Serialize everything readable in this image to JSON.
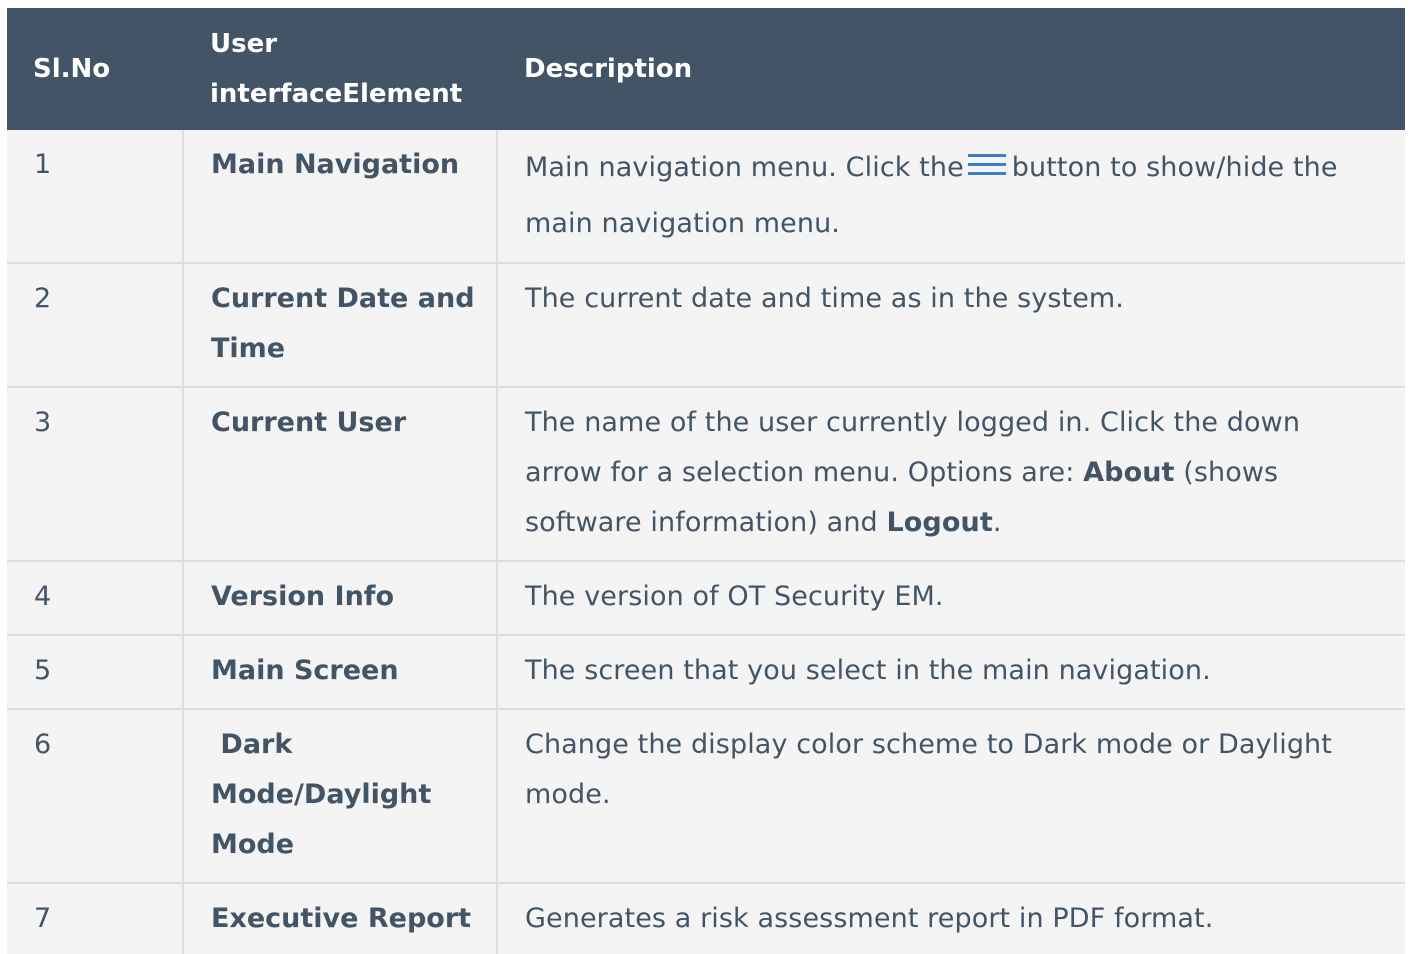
{
  "table": {
    "headers": {
      "sl_no": "Sl.No",
      "element": "User interfaceElement",
      "description": "Description"
    },
    "rows": [
      {
        "num": "1",
        "element": "Main Navigation",
        "desc_before": "Main navigation menu. Click the",
        "icon": "menu-icon",
        "desc_after": "button to show/hide the main navigation menu."
      },
      {
        "num": "2",
        "element": "Current Date and Time",
        "desc": "The current date and time as in the system."
      },
      {
        "num": "3",
        "element": "Current User",
        "desc_part1": "The name of the user currently logged in. Click the down arrow for a selection menu. Options are: ",
        "desc_bold1": "About",
        "desc_part2": " (shows software information) and ",
        "desc_bold2": "Logout",
        "desc_part3": "."
      },
      {
        "num": "4",
        "element": "Version Info",
        "desc": "The version of OT Security EM."
      },
      {
        "num": "5",
        "element": "Main Screen",
        "desc": "The screen that you select in the main navigation."
      },
      {
        "num": "6",
        "element": " Dark Mode/Daylight Mode",
        "desc": "Change the display color scheme to Dark mode or Daylight mode."
      },
      {
        "num": "7",
        "element": "Executive Report",
        "desc": "Generates a risk assessment report in PDF format."
      }
    ]
  },
  "colors": {
    "header_bg": "#425466",
    "header_text": "#ffffff",
    "body_text": "#425466",
    "row_bg": "#f4f4f4",
    "border": "#dddddd",
    "icon": "#3a7fc7"
  }
}
